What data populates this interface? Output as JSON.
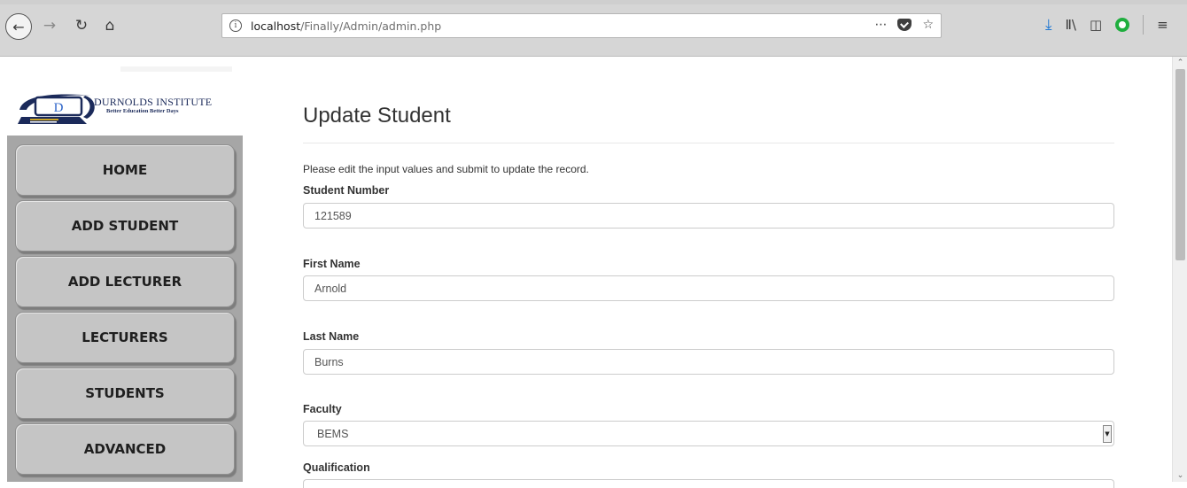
{
  "browser": {
    "url_host": "localhost",
    "url_path": "/Finally/Admin/admin.php",
    "url_actions_label": "⋯",
    "nav": {
      "back_glyph": "←",
      "forward_glyph": "→",
      "reload_glyph": "↻",
      "home_glyph": "⌂"
    },
    "tools": {
      "download_glyph": "⤓",
      "library_glyph": "Ⅱ\\",
      "sidebar_glyph": "◫",
      "menu_glyph": "≡",
      "star_glyph": "☆"
    },
    "icons": [
      "info-icon",
      "pocket-icon",
      "bookmark-star-icon",
      "download-icon",
      "library-icon",
      "sidebar-toggle-icon",
      "green-extension-icon",
      "hamburger-menu-icon"
    ]
  },
  "brand": {
    "name": "DURNOLDS INSTITUTE",
    "tagline": "Better Education Better Days",
    "logo_letter": "D",
    "logo_color": "#1b2a5a"
  },
  "sidebar": {
    "items": [
      {
        "label": "HOME"
      },
      {
        "label": "ADD STUDENT"
      },
      {
        "label": "ADD LECTURER"
      },
      {
        "label": "LECTURERS"
      },
      {
        "label": "STUDENTS"
      },
      {
        "label": "ADVANCED"
      }
    ]
  },
  "form": {
    "title": "Update Student",
    "intro": "Please edit the input values and submit to update the record.",
    "student_number": {
      "label": "Student Number",
      "value": "121589"
    },
    "first_name": {
      "label": "First Name",
      "value": "Arnold"
    },
    "last_name": {
      "label": "Last Name",
      "value": "Burns"
    },
    "faculty": {
      "label": "Faculty",
      "value": "BEMS"
    },
    "qualification": {
      "label": "Qualification"
    }
  },
  "scroll": {
    "position_fraction": 0.0
  }
}
